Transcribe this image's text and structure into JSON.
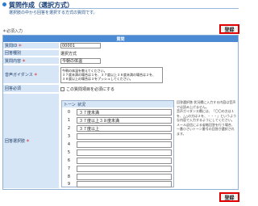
{
  "page": {
    "title": "質問作成（選択方式）",
    "subtitle": "選択肢の中から回答を選択する方式の質問です。",
    "required_note": "＊必須入力",
    "required_star": "＊",
    "register_label": "登録"
  },
  "form": {
    "header": "質問",
    "fields": {
      "question_id": {
        "label": "質問ID",
        "value": "00001"
      },
      "question_type": {
        "label": "回答種別",
        "value": "選択方式"
      },
      "question_content": {
        "label": "質問内容",
        "value": "今朝の体温"
      },
      "voice_guidance": {
        "label": "音声ガイダンス",
        "value": "今朝の体温を教えてください。\n３７度未満の場合は１を、３７度以上３８度未満の場合は２を、\n３８度以上の場合は３をプッシュしてください。"
      },
      "answer_required": {
        "label": "回答必須",
        "checkbox_label": "この質問項目を必須にする"
      },
      "answer_choices": {
        "label": "回答選択肢"
      }
    },
    "choices_table": {
      "headers": [
        "トーン",
        "状況"
      ],
      "rows": [
        {
          "tone": "0",
          "status": "３７度未満"
        },
        {
          "tone": "1",
          "status": "３７度以上３８度未満"
        },
        {
          "tone": "2",
          "status": "３７度以上"
        },
        {
          "tone": "3",
          "status": ""
        },
        {
          "tone": "4",
          "status": ""
        },
        {
          "tone": "5",
          "status": ""
        },
        {
          "tone": "6",
          "status": ""
        },
        {
          "tone": "7",
          "status": ""
        },
        {
          "tone": "8",
          "status": ""
        },
        {
          "tone": "9",
          "status": ""
        }
      ]
    },
    "help_text": "回答選択肢 状況欄に入力する内容は音声では読み上げません。\n音声ガイダンス欄には、「〇〇の方は１を、△△の方は２を、・・・」というような内容で入力するようにしてください。\nメール返信による省略回答を行う場合、一番小さいトーン番号の回答が選択されます。"
  }
}
